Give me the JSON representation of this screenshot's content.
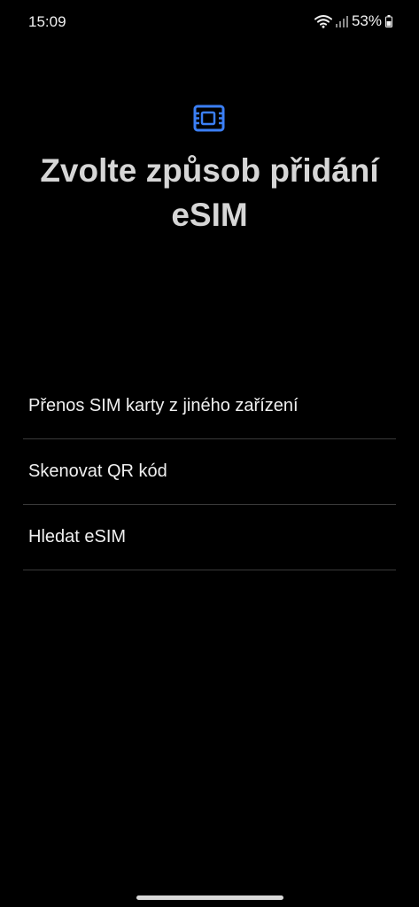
{
  "status_bar": {
    "time": "15:09",
    "battery_percent": "53%",
    "icons": [
      "wifi-icon",
      "signal-icon",
      "battery-icon"
    ]
  },
  "header": {
    "icon": "esim-card-icon",
    "icon_color": "#3b7ff5",
    "title": "Zvolte způsob přidání eSIM"
  },
  "options": [
    {
      "label": "Přenos SIM karty z jiného zařízení"
    },
    {
      "label": "Skenovat QR kód"
    },
    {
      "label": "Hledat eSIM"
    }
  ]
}
